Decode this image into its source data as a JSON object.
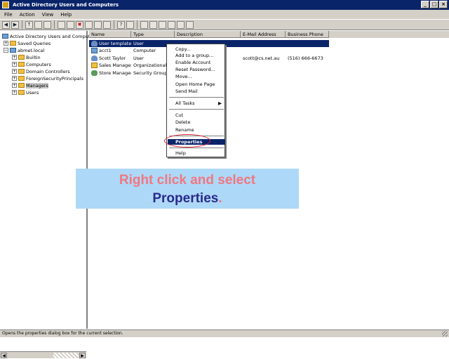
{
  "window": {
    "title": "Active Directory Users and Computers",
    "min": "_",
    "max": "□",
    "close": "×"
  },
  "menubar": {
    "items": [
      "File",
      "Action",
      "View",
      "Help"
    ]
  },
  "toolbar": {
    "back": "◀",
    "forward": "▶",
    "up": "↑",
    "delete": "✖",
    "help": "?"
  },
  "tree": {
    "items": [
      {
        "label": "Active Directory Users and Comput"
      },
      {
        "label": "Saved Queries"
      },
      {
        "label": "abmet.local"
      },
      {
        "label": "Builtin"
      },
      {
        "label": "Computers"
      },
      {
        "label": "Domain Controllers"
      },
      {
        "label": "ForeignSecurityPrincipals"
      },
      {
        "label": "Managers"
      },
      {
        "label": "Users"
      }
    ],
    "collapsed": "+",
    "expanded": "−",
    "scroll_left": "◀",
    "scroll_right": "▶"
  },
  "list": {
    "columns": [
      "Name",
      "Type",
      "Description",
      "E-Mail Address",
      "Business Phone"
    ],
    "rows": [
      {
        "name": "User template",
        "type": "User",
        "description": "",
        "email": "",
        "phone": ""
      },
      {
        "name": "acct1",
        "type": "Computer",
        "description": "",
        "email": "",
        "phone": ""
      },
      {
        "name": "Scott Taylor",
        "type": "User",
        "description": "",
        "email": "scott@cs.net.au",
        "phone": "(516) 666-6673"
      },
      {
        "name": "Sales Managers",
        "type": "Organizational",
        "description": "",
        "email": "",
        "phone": ""
      },
      {
        "name": "Store Managers",
        "type": "Security Group",
        "description": "",
        "email": "",
        "phone": ""
      }
    ]
  },
  "context_menu": {
    "items": [
      {
        "label": "Copy..."
      },
      {
        "label": "Add to a group..."
      },
      {
        "label": "Enable Account"
      },
      {
        "label": "Reset Password..."
      },
      {
        "label": "Move..."
      },
      {
        "label": "Open Home Page"
      },
      {
        "label": "Send Mail"
      },
      {
        "label": "All Tasks"
      },
      {
        "label": "Cut"
      },
      {
        "label": "Delete"
      },
      {
        "label": "Rename"
      },
      {
        "label": "Properties"
      },
      {
        "label": "Help"
      }
    ],
    "submenu_arrow": "▶"
  },
  "callout": {
    "line1": "Right click and select",
    "line2_bold": "Properties",
    "line2_end": "."
  },
  "statusbar": {
    "text": "Opens the properties dialog box for the current selection."
  },
  "colors": {
    "titlebar": "#0a246a",
    "selection": "#0a246a",
    "highlight_circle": "#e02030",
    "callout_bg": "#aed8f8",
    "callout_pink": "#f07880",
    "callout_navy": "#2a2a8a"
  }
}
